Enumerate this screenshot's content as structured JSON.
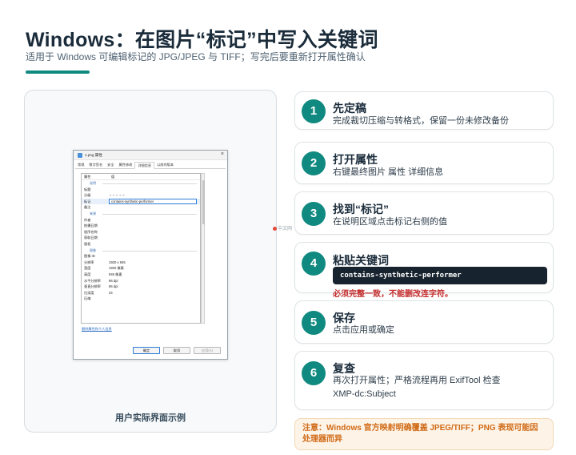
{
  "header": {
    "title": "Windows：在图片“标记”中写入关键词",
    "subtitle": "适用于 Windows 可编辑标记的 JPG/JPEG 与 TIFF；写完后要重新打开属性确认"
  },
  "colors": {
    "accent": "#108a80",
    "warn": "#c22a2a",
    "note_bg": "#fdf3e7",
    "note_text": "#d06a16"
  },
  "screenshot_panel": {
    "caption": "用户实际界面示例",
    "dialog": {
      "title": "1.png 属性",
      "close_glyph": "×",
      "tabs": [
        "常规",
        "数字签名",
        "安全",
        "属性修改",
        "详细信息",
        "以前的版本"
      ],
      "active_tab": 4,
      "header": {
        "k": "属性",
        "v": "值"
      },
      "section_description": "说明",
      "rows_description": [
        {
          "k": "标题",
          "v": ""
        },
        {
          "k": "分级",
          "v": "★★★★★"
        },
        {
          "k": "标记",
          "v": "contains-synthetic-performer"
        },
        {
          "k": "备注",
          "v": ""
        }
      ],
      "section_origin": "来源",
      "rows_origin": [
        {
          "k": "作者",
          "v": ""
        },
        {
          "k": "拍摄日期",
          "v": ""
        },
        {
          "k": "程序名称",
          "v": ""
        },
        {
          "k": "获取日期",
          "v": ""
        },
        {
          "k": "版权",
          "v": ""
        }
      ],
      "section_image": "图像",
      "rows_image": [
        {
          "k": "图像 ID",
          "v": ""
        },
        {
          "k": "分辨率",
          "v": "1920 x 945"
        },
        {
          "k": "宽度",
          "v": "1920 像素"
        },
        {
          "k": "高度",
          "v": "945 像素"
        },
        {
          "k": "水平分辨率",
          "v": "96 dpi"
        },
        {
          "k": "垂直分辨率",
          "v": "96 dpi"
        },
        {
          "k": "位深度",
          "v": "24"
        },
        {
          "k": "压缩",
          "v": ""
        }
      ],
      "link": "删除属性和个人信息",
      "buttons": {
        "ok": "确定",
        "cancel": "取消",
        "apply": "应用(A)"
      }
    }
  },
  "watermark": "中文网",
  "steps": [
    {
      "num": "1",
      "title": "先定稿",
      "desc": "完成裁切压缩与转格式，保留一份未修改备份"
    },
    {
      "num": "2",
      "title": "打开属性",
      "desc": "右键最终图片  属性  详细信息"
    },
    {
      "num": "3",
      "title": "找到“标记”",
      "desc": "在说明区域点击标记右侧的值"
    },
    {
      "num": "4",
      "title": "粘贴关键词",
      "code": "contains-synthetic-performer",
      "warning": "必须完整一致，不能删改连字符。"
    },
    {
      "num": "5",
      "title": "保存",
      "desc": "点击应用或确定"
    },
    {
      "num": "6",
      "title": "复查",
      "desc_line1": "再次打开属性；严格流程再用 ExifTool 检查",
      "desc_line2": "XMP-dc:Subject"
    }
  ],
  "note": "注意：Windows 官方映射明确覆盖 JPEG/TIFF；PNG 表现可能因处理器而异"
}
